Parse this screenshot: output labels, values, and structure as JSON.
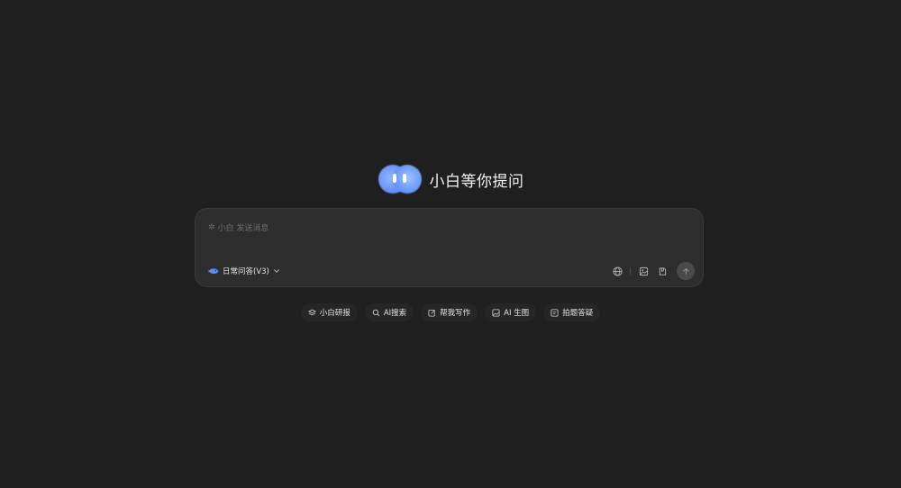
{
  "hero": {
    "title": "小白等你提问",
    "logo_icon": "xiaobai-logo-icon"
  },
  "composer": {
    "placeholder_prefix": "✲",
    "placeholder": "小白 发送消息",
    "mode_label": "日常问答(V3)",
    "mode_icon": "whale-icon",
    "tools": [
      "globe-icon",
      "image-icon",
      "file-icon"
    ],
    "send_icon": "arrow-up-icon"
  },
  "chips": [
    {
      "label": "小白研报",
      "icon": "layers-icon"
    },
    {
      "label": "AI搜索",
      "icon": "search-icon"
    },
    {
      "label": "帮我写作",
      "icon": "pen-icon"
    },
    {
      "label": "AI 生图",
      "icon": "image-icon"
    },
    {
      "label": "拍题答疑",
      "icon": "scan-icon"
    }
  ],
  "colors": {
    "background": "#1f1f1f",
    "card": "#2d2d2d",
    "accent": "#6b93f5"
  }
}
